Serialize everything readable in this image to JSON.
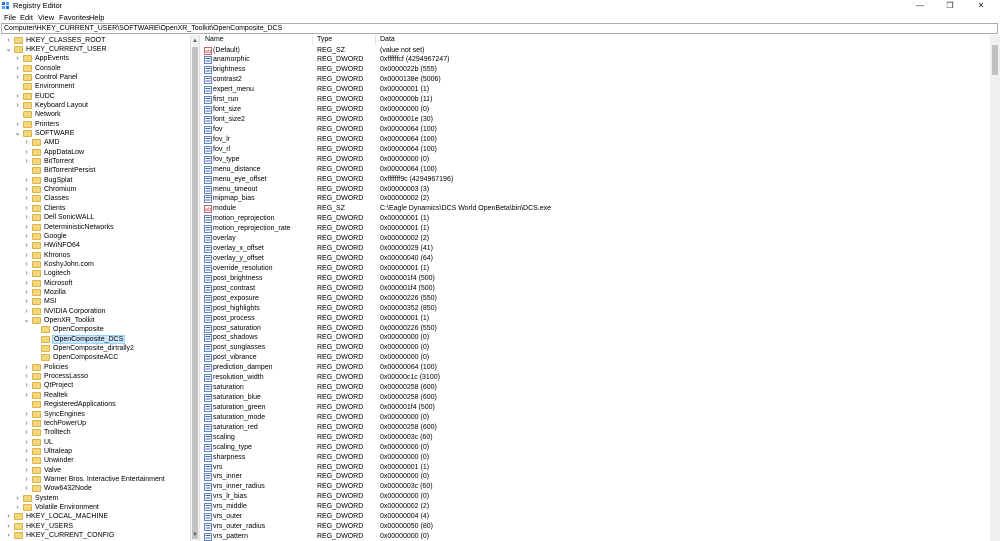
{
  "window": {
    "title": "Registry Editor",
    "minimize": "—",
    "maximize": "❐",
    "close": "✕"
  },
  "menu": [
    "File",
    "Edit",
    "View",
    "Favorites",
    "Help"
  ],
  "address": "Computer\\HKEY_CURRENT_USER\\SOFTWARE\\OpenXR_Toolkit\\OpenComposite_DCS",
  "tree": [
    {
      "label": "HKEY_CLASSES_ROOT",
      "level": 1,
      "exp": "›"
    },
    {
      "label": "HKEY_CURRENT_USER",
      "level": 1,
      "exp": "⌄"
    },
    {
      "label": "AppEvents",
      "level": 2,
      "exp": "›"
    },
    {
      "label": "Console",
      "level": 2,
      "exp": "›"
    },
    {
      "label": "Control Panel",
      "level": 2,
      "exp": "›"
    },
    {
      "label": "Environment",
      "level": 2,
      "exp": ""
    },
    {
      "label": "EUDC",
      "level": 2,
      "exp": "›"
    },
    {
      "label": "Keyboard Layout",
      "level": 2,
      "exp": "›"
    },
    {
      "label": "Network",
      "level": 2,
      "exp": ""
    },
    {
      "label": "Printers",
      "level": 2,
      "exp": "›"
    },
    {
      "label": "SOFTWARE",
      "level": 2,
      "exp": "⌄"
    },
    {
      "label": "AMD",
      "level": 3,
      "exp": "›"
    },
    {
      "label": "AppDataLow",
      "level": 3,
      "exp": "›"
    },
    {
      "label": "BitTorrent",
      "level": 3,
      "exp": "›"
    },
    {
      "label": "BitTorrentPersist",
      "level": 3,
      "exp": ""
    },
    {
      "label": "BugSplat",
      "level": 3,
      "exp": "›"
    },
    {
      "label": "Chromium",
      "level": 3,
      "exp": "›"
    },
    {
      "label": "Classes",
      "level": 3,
      "exp": "›"
    },
    {
      "label": "Clients",
      "level": 3,
      "exp": "›"
    },
    {
      "label": "Dell SonicWALL",
      "level": 3,
      "exp": "›"
    },
    {
      "label": "DeterministicNetworks",
      "level": 3,
      "exp": "›"
    },
    {
      "label": "Google",
      "level": 3,
      "exp": "›"
    },
    {
      "label": "HWiNFO64",
      "level": 3,
      "exp": "›"
    },
    {
      "label": "Khronos",
      "level": 3,
      "exp": "›"
    },
    {
      "label": "KoshyJohn.com",
      "level": 3,
      "exp": "›"
    },
    {
      "label": "Logitech",
      "level": 3,
      "exp": "›"
    },
    {
      "label": "Microsoft",
      "level": 3,
      "exp": "›"
    },
    {
      "label": "Mozilla",
      "level": 3,
      "exp": "›"
    },
    {
      "label": "MSI",
      "level": 3,
      "exp": "›"
    },
    {
      "label": "NVIDIA Corporation",
      "level": 3,
      "exp": "›"
    },
    {
      "label": "OpenXR_Toolkit",
      "level": 3,
      "exp": "⌄"
    },
    {
      "label": "OpenComposite",
      "level": 4,
      "exp": ""
    },
    {
      "label": "OpenComposite_DCS",
      "level": 4,
      "exp": "",
      "selected": true
    },
    {
      "label": "OpenComposite_dirtrally2",
      "level": 4,
      "exp": ""
    },
    {
      "label": "OpenCompositeACC",
      "level": 4,
      "exp": ""
    },
    {
      "label": "Policies",
      "level": 3,
      "exp": "›"
    },
    {
      "label": "ProcessLasso",
      "level": 3,
      "exp": "›"
    },
    {
      "label": "QtProject",
      "level": 3,
      "exp": "›"
    },
    {
      "label": "Realtek",
      "level": 3,
      "exp": "›"
    },
    {
      "label": "RegisteredApplications",
      "level": 3,
      "exp": ""
    },
    {
      "label": "SyncEngines",
      "level": 3,
      "exp": "›"
    },
    {
      "label": "techPowerUp",
      "level": 3,
      "exp": "›"
    },
    {
      "label": "Trolltech",
      "level": 3,
      "exp": "›"
    },
    {
      "label": "UL",
      "level": 3,
      "exp": "›"
    },
    {
      "label": "Ultraleap",
      "level": 3,
      "exp": "›"
    },
    {
      "label": "Unwinder",
      "level": 3,
      "exp": "›"
    },
    {
      "label": "Valve",
      "level": 3,
      "exp": "›"
    },
    {
      "label": "Warner Bros. Interactive Entertainment",
      "level": 3,
      "exp": "›"
    },
    {
      "label": "Wow6432Node",
      "level": 3,
      "exp": "›"
    },
    {
      "label": "System",
      "level": 2,
      "exp": "›"
    },
    {
      "label": "Volatile Environment",
      "level": 2,
      "exp": "›"
    },
    {
      "label": "HKEY_LOCAL_MACHINE",
      "level": 1,
      "exp": "›"
    },
    {
      "label": "HKEY_USERS",
      "level": 1,
      "exp": "›"
    },
    {
      "label": "HKEY_CURRENT_CONFIG",
      "level": 1,
      "exp": "›"
    }
  ],
  "columns": {
    "name": "Name",
    "type": "Type",
    "data": "Data"
  },
  "values": [
    {
      "name": "(Default)",
      "type": "REG_SZ",
      "data": "(value not set)"
    },
    {
      "name": "anamorphic",
      "type": "REG_DWORD",
      "data": "0xffffffcf (4294967247)"
    },
    {
      "name": "brightness",
      "type": "REG_DWORD",
      "data": "0x0000022b (555)"
    },
    {
      "name": "contrast2",
      "type": "REG_DWORD",
      "data": "0x0000138e (5006)"
    },
    {
      "name": "expert_menu",
      "type": "REG_DWORD",
      "data": "0x00000001 (1)"
    },
    {
      "name": "first_run",
      "type": "REG_DWORD",
      "data": "0x0000000b (11)"
    },
    {
      "name": "font_size",
      "type": "REG_DWORD",
      "data": "0x00000000 (0)"
    },
    {
      "name": "font_size2",
      "type": "REG_DWORD",
      "data": "0x0000001e (30)"
    },
    {
      "name": "fov",
      "type": "REG_DWORD",
      "data": "0x00000064 (100)"
    },
    {
      "name": "fov_lr",
      "type": "REG_DWORD",
      "data": "0x00000064 (100)"
    },
    {
      "name": "fov_rl",
      "type": "REG_DWORD",
      "data": "0x00000064 (100)"
    },
    {
      "name": "fov_type",
      "type": "REG_DWORD",
      "data": "0x00000000 (0)"
    },
    {
      "name": "menu_distance",
      "type": "REG_DWORD",
      "data": "0x00000064 (100)"
    },
    {
      "name": "menu_eye_offset",
      "type": "REG_DWORD",
      "data": "0xfffffff9c (4294967196)"
    },
    {
      "name": "menu_timeout",
      "type": "REG_DWORD",
      "data": "0x00000003 (3)"
    },
    {
      "name": "mipmap_bias",
      "type": "REG_DWORD",
      "data": "0x00000002 (2)"
    },
    {
      "name": "module",
      "type": "REG_SZ",
      "data": "C:\\Eagle Dynamics\\DCS World OpenBeta\\bin\\DCS.exe"
    },
    {
      "name": "motion_reprojection",
      "type": "REG_DWORD",
      "data": "0x00000001 (1)"
    },
    {
      "name": "motion_reprojection_rate",
      "type": "REG_DWORD",
      "data": "0x00000001 (1)"
    },
    {
      "name": "overlay",
      "type": "REG_DWORD",
      "data": "0x00000002 (2)"
    },
    {
      "name": "overlay_x_offset",
      "type": "REG_DWORD",
      "data": "0x00000029 (41)"
    },
    {
      "name": "overlay_y_offset",
      "type": "REG_DWORD",
      "data": "0x00000040 (64)"
    },
    {
      "name": "override_resolution",
      "type": "REG_DWORD",
      "data": "0x00000001 (1)"
    },
    {
      "name": "post_brightness",
      "type": "REG_DWORD",
      "data": "0x000001f4 (500)"
    },
    {
      "name": "post_contrast",
      "type": "REG_DWORD",
      "data": "0x000001f4 (500)"
    },
    {
      "name": "post_exposure",
      "type": "REG_DWORD",
      "data": "0x00000226 (550)"
    },
    {
      "name": "post_highlights",
      "type": "REG_DWORD",
      "data": "0x00000352 (850)"
    },
    {
      "name": "post_process",
      "type": "REG_DWORD",
      "data": "0x00000001 (1)"
    },
    {
      "name": "post_saturation",
      "type": "REG_DWORD",
      "data": "0x00000226 (550)"
    },
    {
      "name": "post_shadows",
      "type": "REG_DWORD",
      "data": "0x00000000 (0)"
    },
    {
      "name": "post_sunglasses",
      "type": "REG_DWORD",
      "data": "0x00000000 (0)"
    },
    {
      "name": "post_vibrance",
      "type": "REG_DWORD",
      "data": "0x00000000 (0)"
    },
    {
      "name": "prediction_dampen",
      "type": "REG_DWORD",
      "data": "0x00000064 (100)"
    },
    {
      "name": "resolution_width",
      "type": "REG_DWORD",
      "data": "0x00000c1c (3100)"
    },
    {
      "name": "saturation",
      "type": "REG_DWORD",
      "data": "0x00000258 (600)"
    },
    {
      "name": "saturation_blue",
      "type": "REG_DWORD",
      "data": "0x00000258 (600)"
    },
    {
      "name": "saturation_green",
      "type": "REG_DWORD",
      "data": "0x000001f4 (500)"
    },
    {
      "name": "saturation_mode",
      "type": "REG_DWORD",
      "data": "0x00000000 (0)"
    },
    {
      "name": "saturation_red",
      "type": "REG_DWORD",
      "data": "0x00000258 (600)"
    },
    {
      "name": "scaling",
      "type": "REG_DWORD",
      "data": "0x0000003c (60)"
    },
    {
      "name": "scaling_type",
      "type": "REG_DWORD",
      "data": "0x00000000 (0)"
    },
    {
      "name": "sharpness",
      "type": "REG_DWORD",
      "data": "0x00000000 (0)"
    },
    {
      "name": "vrs",
      "type": "REG_DWORD",
      "data": "0x00000001 (1)"
    },
    {
      "name": "vrs_inner",
      "type": "REG_DWORD",
      "data": "0x00000000 (0)"
    },
    {
      "name": "vrs_inner_radius",
      "type": "REG_DWORD",
      "data": "0x0000003c (60)"
    },
    {
      "name": "vrs_lr_bias",
      "type": "REG_DWORD",
      "data": "0x00000000 (0)"
    },
    {
      "name": "vrs_middle",
      "type": "REG_DWORD",
      "data": "0x00000002 (2)"
    },
    {
      "name": "vrs_outer",
      "type": "REG_DWORD",
      "data": "0x00000004 (4)"
    },
    {
      "name": "vrs_outer_radius",
      "type": "REG_DWORD",
      "data": "0x00000050 (80)"
    },
    {
      "name": "vrs_pattern",
      "type": "REG_DWORD",
      "data": "0x00000000 (0)"
    }
  ]
}
